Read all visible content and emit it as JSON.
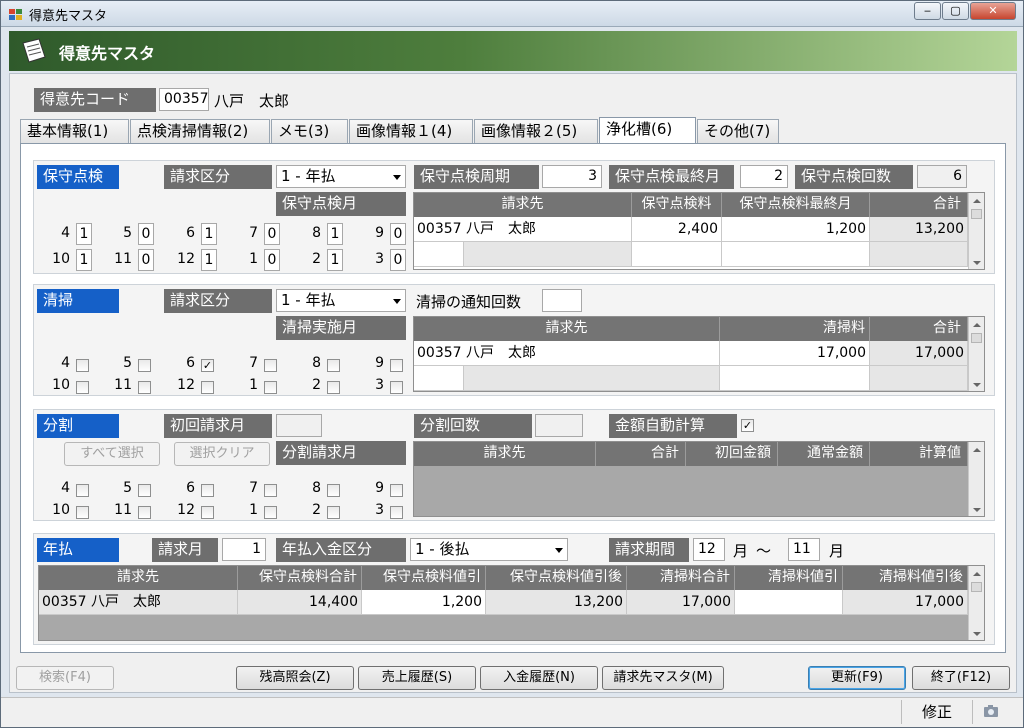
{
  "window": {
    "title": "得意先マスタ",
    "min": "‒",
    "max": "▢",
    "close": "✕"
  },
  "banner": {
    "title": "得意先マスタ"
  },
  "customer": {
    "label": "得意先コード",
    "code": "00357",
    "name": "八戸　太郎"
  },
  "tabs": [
    "基本情報(1)",
    "点検清掃情報(2)",
    "メモ(3)",
    "画像情報１(4)",
    "画像情報２(5)",
    "浄化槽(6)",
    "その他(7)"
  ],
  "maint": {
    "title": "保守点検",
    "billing_label": "請求区分",
    "billing_value": "1 - 年払",
    "months_label": "保守点検月",
    "cycle_label": "保守点検周期",
    "cycle_value": "3",
    "last_label": "保守点検最終月",
    "last_value": "2",
    "count_label": "保守点検回数",
    "count_value": "6",
    "months_row1": [
      {
        "m": "4",
        "v": "1"
      },
      {
        "m": "5",
        "v": "0"
      },
      {
        "m": "6",
        "v": "1"
      },
      {
        "m": "7",
        "v": "0"
      },
      {
        "m": "8",
        "v": "1"
      },
      {
        "m": "9",
        "v": "0"
      }
    ],
    "months_row2": [
      {
        "m": "10",
        "v": "1"
      },
      {
        "m": "11",
        "v": "0"
      },
      {
        "m": "12",
        "v": "1"
      },
      {
        "m": "1",
        "v": "0"
      },
      {
        "m": "2",
        "v": "1"
      },
      {
        "m": "3",
        "v": "0"
      }
    ],
    "grid_headers": [
      "請求先",
      "保守点検料",
      "保守点検料最終月",
      "合計"
    ],
    "grid_row": [
      "00357 八戸　太郎",
      "2,400",
      "1,200",
      "13,200"
    ]
  },
  "cleaning": {
    "title": "清掃",
    "billing_label": "請求区分",
    "billing_value": "1 - 年払",
    "months_label": "清掃実施月",
    "notify_label": "清掃の通知回数",
    "notify_value": "",
    "months_row1": [
      {
        "m": "4",
        "c": ""
      },
      {
        "m": "5",
        "c": ""
      },
      {
        "m": "6",
        "c": "✓"
      },
      {
        "m": "7",
        "c": ""
      },
      {
        "m": "8",
        "c": ""
      },
      {
        "m": "9",
        "c": ""
      }
    ],
    "months_row2": [
      {
        "m": "10",
        "c": ""
      },
      {
        "m": "11",
        "c": ""
      },
      {
        "m": "12",
        "c": ""
      },
      {
        "m": "1",
        "c": ""
      },
      {
        "m": "2",
        "c": ""
      },
      {
        "m": "3",
        "c": ""
      }
    ],
    "grid_headers": [
      "請求先",
      "清掃料",
      "合計"
    ],
    "grid_row": [
      "00357 八戸　太郎",
      "17,000",
      "17,000"
    ]
  },
  "split": {
    "title": "分割",
    "first_label": "初回請求月",
    "first_value": "",
    "count_label": "分割回数",
    "count_value": "",
    "auto_label": "金額自動計算",
    "auto_checked": "✓",
    "select_all": "すべて選択",
    "clear": "選択クリア",
    "months_label": "分割請求月",
    "months_row1": [
      "4",
      "5",
      "6",
      "7",
      "8",
      "9"
    ],
    "months_row2": [
      "10",
      "11",
      "12",
      "1",
      "2",
      "3"
    ],
    "grid_headers": [
      "請求先",
      "合計",
      "初回金額",
      "通常金額",
      "計算値"
    ]
  },
  "annual": {
    "title": "年払",
    "month_label": "請求月",
    "month_value": "1",
    "deposit_label": "年払入金区分",
    "deposit_value": "1 - 後払",
    "period_label": "請求期間",
    "period_from": "12",
    "month_unit": "月",
    "tilde": "～",
    "period_to": "11",
    "grid_headers": [
      "請求先",
      "保守点検料合計",
      "保守点検料値引",
      "保守点検料値引後",
      "清掃料合計",
      "清掃料値引",
      "清掃料値引後"
    ],
    "grid_row": [
      "00357 八戸　太郎",
      "14,400",
      "1,200",
      "13,200",
      "17,000",
      "",
      "17,000"
    ]
  },
  "buttons": {
    "search": "検索(F4)",
    "balance": "残高照会(Z)",
    "sales": "売上履歴(S)",
    "payment": "入金履歴(N)",
    "billing_master": "請求先マスタ(M)",
    "update": "更新(F9)",
    "exit": "終了(F12)"
  },
  "status": {
    "mode": "修正"
  }
}
